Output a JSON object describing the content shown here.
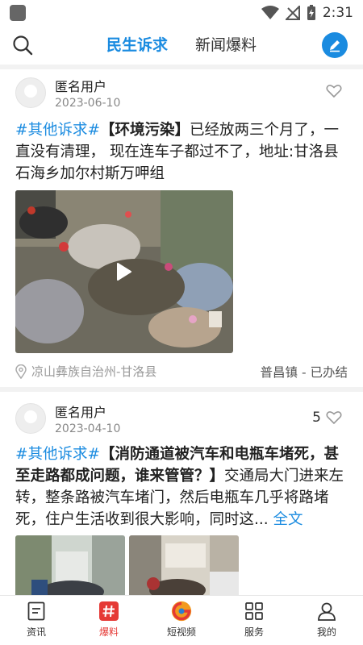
{
  "status_bar": {
    "time": "2:31"
  },
  "header": {
    "tabs": [
      {
        "label": "民生诉求",
        "active": true
      },
      {
        "label": "新闻爆料",
        "active": false
      }
    ]
  },
  "posts": [
    {
      "user": "匿名用户",
      "date": "2023-06-10",
      "likes": "",
      "tag": "#其他诉求#",
      "title": "【环境污染】",
      "body": "已经放两三个月了，一直没有清理， 现在连车子都过不了，地址:甘洛县石海乡加尔村斯万呷组",
      "location": "凉山彝族自治州-甘洛县",
      "status": "普昌镇 - 已办结"
    },
    {
      "user": "匿名用户",
      "date": "2023-04-10",
      "likes": "5",
      "tag": "#其他诉求#",
      "title": "【消防通道被汽车和电瓶车堵死，甚至走路都成问题，谁来管管？】",
      "body": "交通局大门进来左转，整条路被汽车堵门，然后电瓶车几乎将路堵死，住户生活收到很大影响，同时这...",
      "full_link": "全文"
    }
  ],
  "bottom_nav": [
    {
      "label": "资讯",
      "icon": "news-icon"
    },
    {
      "label": "爆料",
      "icon": "hashtag-icon",
      "active": true
    },
    {
      "label": "短视频",
      "icon": "short-video-logo-icon"
    },
    {
      "label": "服务",
      "icon": "grid-icon"
    },
    {
      "label": "我的",
      "icon": "profile-icon"
    }
  ],
  "colors": {
    "accent": "#1a8be0",
    "nav_active": "#e53935"
  }
}
